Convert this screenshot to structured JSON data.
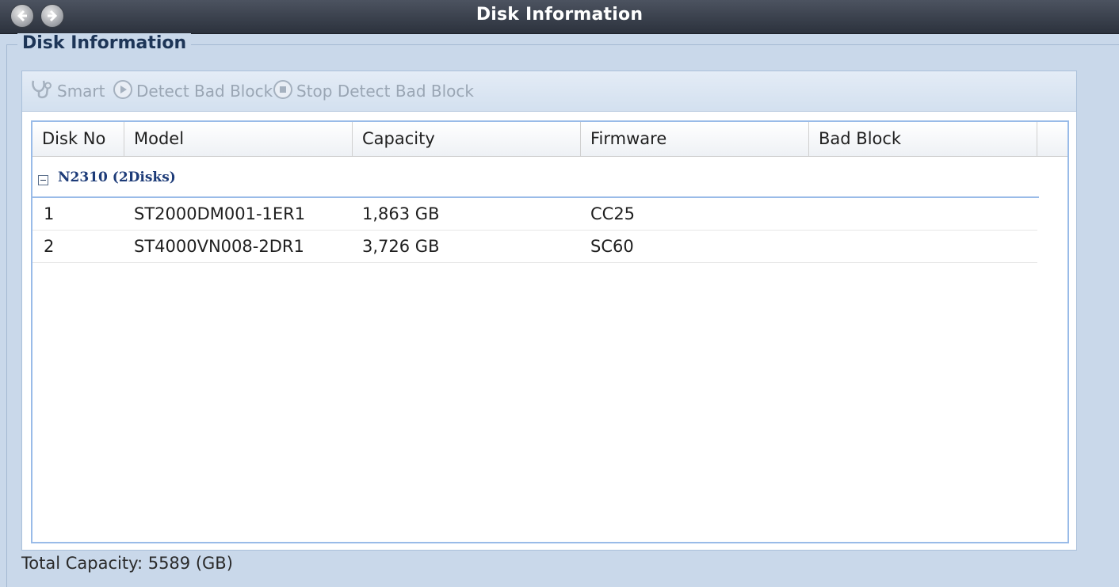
{
  "window": {
    "title": "Disk Information"
  },
  "section": {
    "legend": "Disk Information"
  },
  "toolbar": {
    "smart_label": "Smart",
    "detect_label": "Detect Bad Block",
    "stop_label": "Stop Detect Bad Block"
  },
  "grid": {
    "columns": [
      "Disk No",
      "Model",
      "Capacity",
      "Firmware",
      "Bad Block"
    ],
    "group_label": "N2310 (2Disks)",
    "rows": [
      {
        "disk_no": "1",
        "model": "ST2000DM001-1ER1",
        "capacity": "1,863 GB",
        "firmware": "CC25",
        "bad_block": ""
      },
      {
        "disk_no": "2",
        "model": "ST4000VN008-2DR1",
        "capacity": "3,726 GB",
        "firmware": "SC60",
        "bad_block": ""
      }
    ]
  },
  "footer": {
    "total_capacity": "Total Capacity: 5589 (GB)"
  },
  "icons": {
    "back": "arrow-left-icon",
    "forward": "arrow-right-icon",
    "smart": "stethoscope-icon",
    "detect": "play-circle-icon",
    "stop": "stop-circle-icon",
    "group_toggle": "collapse-minus-icon"
  },
  "colors": {
    "titlebar": "#2c323d",
    "background": "#c9d8ea",
    "grid_border": "#99bbe8",
    "group_text": "#1d3b78"
  }
}
